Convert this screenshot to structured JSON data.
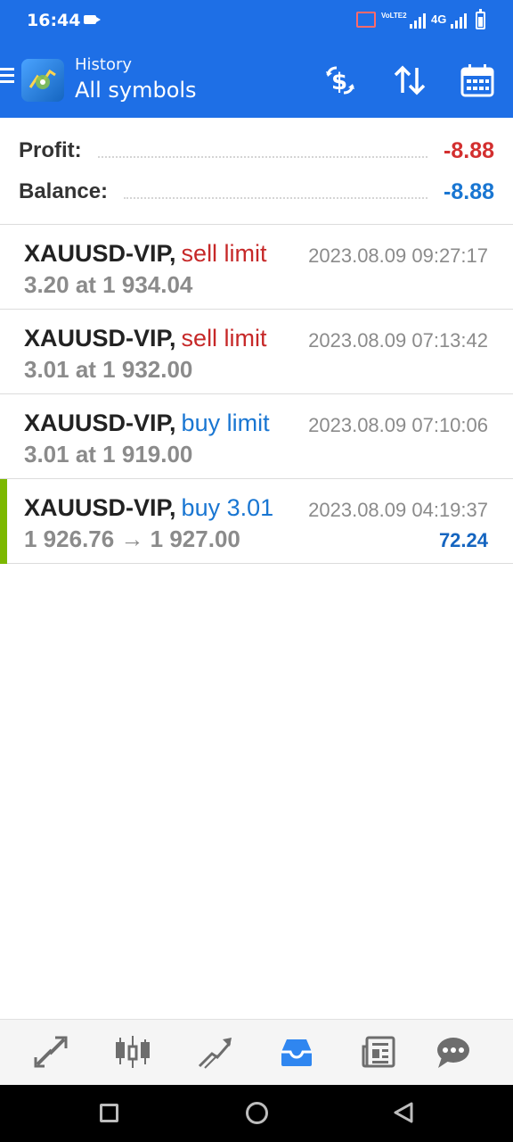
{
  "status_bar": {
    "time": "16:44",
    "network": "4G",
    "volte": "VoLTE2"
  },
  "app_bar": {
    "subtitle": "History",
    "title": "All symbols",
    "icons": [
      "menu-icon",
      "app-logo-icon",
      "currency-exchange-icon",
      "sort-icon",
      "calendar-icon"
    ]
  },
  "summary": {
    "profit_label": "Profit:",
    "profit_value": "-8.88",
    "balance_label": "Balance:",
    "balance_value": "-8.88"
  },
  "orders": [
    {
      "symbol": "XAUUSD-VIP,",
      "action": "sell limit",
      "details": "3.20 at 1 934.04",
      "time": "2023.08.09 09:27:17",
      "profit": ""
    },
    {
      "symbol": "XAUUSD-VIP,",
      "action": "sell limit",
      "details": "3.01 at 1 932.00",
      "time": "2023.08.09 07:13:42",
      "profit": ""
    },
    {
      "symbol": "XAUUSD-VIP,",
      "action": "buy limit",
      "details": "3.01 at 1 919.00",
      "time": "2023.08.09 07:10:06",
      "profit": ""
    },
    {
      "symbol": "XAUUSD-VIP,",
      "action": "buy 3.01",
      "details": "1 926.76 → 1 927.00",
      "time": "2023.08.09 04:19:37",
      "profit": "72.24"
    }
  ],
  "bottom_nav": [
    "quotes-icon",
    "chart-icon",
    "trade-icon",
    "history-icon",
    "news-icon",
    "chat-icon"
  ],
  "colors": {
    "brand": "#1e6fe6",
    "sell": "#c62828",
    "buy": "#1976d2",
    "negative": "#d32f2f",
    "balance": "#1976d2",
    "profit_positive": "#1565c0",
    "marker": "#7cb800",
    "active_nav": "#2f86f0"
  }
}
